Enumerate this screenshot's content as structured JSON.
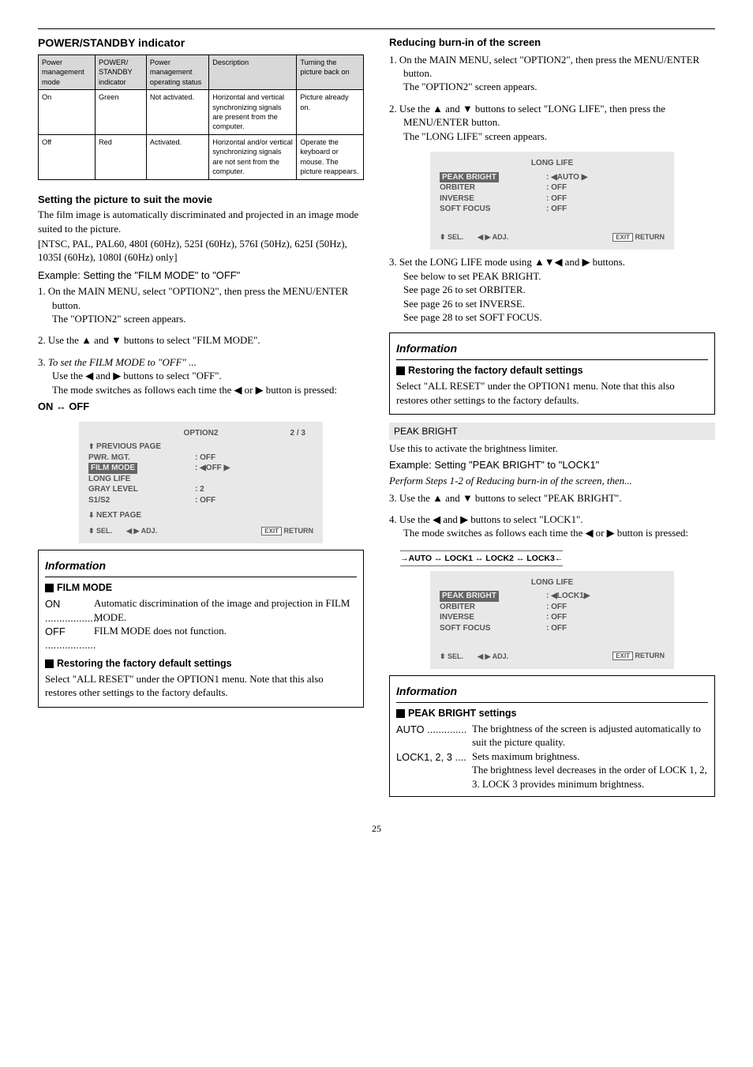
{
  "left": {
    "h_power_standby": "POWER/STANDBY indicator",
    "table": {
      "h1": "Power management mode",
      "h2": "POWER/ STANDBY indicator",
      "h3": "Power management operating status",
      "h4": "Description",
      "h5": "Turning the picture back on",
      "r1c1": "On",
      "r1c2": "Green",
      "r1c3": "Not activated.",
      "r1c4": "Horizontal and vertical synchronizing signals are present from the computer.",
      "r1c5": "Picture already on.",
      "r2c1": "Off",
      "r2c2": "Red",
      "r2c3": "Activated.",
      "r2c4": "Horizontal and/or vertical synchronizing signals are not sent from the computer.",
      "r2c5": "Operate the keyboard or mouse. The picture reappears."
    },
    "h_setting_picture": "Setting the picture to suit the movie",
    "p_setting1": "The film image is automatically discriminated and projected in an image mode suited to the picture.",
    "p_setting2": "[NTSC, PAL, PAL60, 480I (60Hz), 525I (60Hz), 576I (50Hz), 625I (50Hz), 1035I (60Hz), 1080I (60Hz) only]",
    "p_example": "Example: Setting the \"FILM MODE\" to \"OFF\"",
    "li1": "1. On the MAIN MENU, select \"OPTION2\", then press the MENU/ENTER button.\nThe \"OPTION2\" screen appears.",
    "li2": "2. Use the ▲ and ▼ buttons to select \"FILM MODE\".",
    "li3a": "3. ",
    "li3b": "To set the FILM MODE to \"OFF\" ...",
    "li3c": "Use the ◀ and ▶ buttons to select \"OFF\".\nThe mode switches as follows each time the ◀ or ▶ button is pressed:",
    "onoff": "ON ↔ OFF",
    "osd1": {
      "title": "OPTION2",
      "page": "2 / 3",
      "prev": "PREVIOUS PAGE",
      "r1l": "PWR. MGT.",
      "r1v": ":    OFF",
      "r2l": "FILM MODE",
      "r2v": ": ◀OFF ▶",
      "r3l": "LONG LIFE",
      "r4l": "GRAY LEVEL",
      "r4v": ":    2",
      "r5l": "S1/S2",
      "r5v": ":    OFF",
      "next": "NEXT PAGE",
      "sel": "SEL.",
      "adj": "ADJ.",
      "ret": "RETURN"
    },
    "info_h": "Information",
    "film_mode": "FILM MODE",
    "film_on_k": "ON ...................",
    "film_on_v": "Automatic discrimination of the image and projection in FILM MODE.",
    "film_off_k": "OFF ..................",
    "film_off_v": "FILM MODE  does not function.",
    "restoring": "Restoring the factory default settings",
    "restoring_p": "Select \"ALL RESET\" under the OPTION1 menu. Note that this also restores other settings to the factory defaults."
  },
  "right": {
    "h_burn": "Reducing burn-in of the screen",
    "li1": "1. On the MAIN MENU, select \"OPTION2\", then press the MENU/ENTER button.\nThe \"OPTION2\" screen appears.",
    "li2": "2. Use the ▲ and ▼ buttons to select \"LONG LIFE\", then press the MENU/ENTER button.\nThe \"LONG LIFE\" screen appears.",
    "osd2": {
      "title": "LONG LIFE",
      "r1l": "PEAK BRIGHT",
      "r1v": ": ◀AUTO  ▶",
      "r2l": "ORBITER",
      "r2v": ":    OFF",
      "r3l": "INVERSE",
      "r3v": ":    OFF",
      "r4l": "SOFT FOCUS",
      "r4v": ":    OFF",
      "sel": "SEL.",
      "adj": "ADJ.",
      "ret": "RETURN"
    },
    "li3": "3. Set the LONG LIFE mode using ▲▼◀ and ▶ buttons.\nSee below to set PEAK BRIGHT.\nSee page 26 to set ORBITER.\nSee page 26 to set INVERSE.\nSee page 28 to set SOFT FOCUS.",
    "info_h": "Information",
    "restoring": "Restoring the factory default settings",
    "restoring_p": "Select \"ALL RESET\" under the OPTION1 menu. Note that this also restores other settings to the factory defaults.",
    "peak_h": "PEAK BRIGHT",
    "peak_p1": "Use this to activate the brightness limiter.",
    "peak_ex": "Example: Setting \"PEAK BRIGHT\" to \"LOCK1\"",
    "peak_it": "Perform Steps 1-2 of Reducing burn-in of the screen, then...",
    "peak_li3": "3. Use the ▲ and ▼ buttons to select \"PEAK BRIGHT\".",
    "peak_li4": "4. Use the ◀ and ▶ buttons to select \"LOCK1\".\nThe mode switches as follows each time the ◀ or ▶ button is pressed:",
    "cycle": "→AUTO  ↔ LOCK1 ↔ LOCK2 ↔ LOCK3←",
    "osd3": {
      "title": "LONG LIFE",
      "r1l": "PEAK BRIGHT",
      "r1v": ": ◀LOCK1▶",
      "r2l": "ORBITER",
      "r2v": ":    OFF",
      "r3l": "INVERSE",
      "r3v": ":    OFF",
      "r4l": "SOFT FOCUS",
      "r4v": ":    OFF",
      "sel": "SEL.",
      "adj": "ADJ.",
      "ret": "RETURN"
    },
    "info_h2": "Information",
    "pb_settings": "PEAK BRIGHT settings",
    "auto_k": "AUTO ..............",
    "auto_v": "The brightness of the screen is adjusted automatically to suit the picture quality.",
    "lock_k": "LOCK1, 2, 3 ....",
    "lock_v": "Sets maximum brightness.\nThe brightness level decreases in the order  of LOCK 1, 2, 3. LOCK 3 provides minimum brightness."
  },
  "pagenum": "25"
}
